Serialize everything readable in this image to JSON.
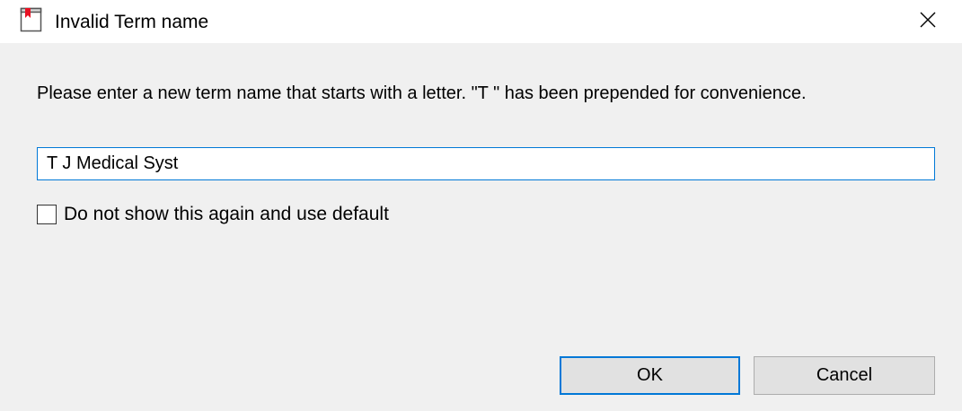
{
  "window": {
    "title": "Invalid Term name",
    "app_icon": "document-bookmark-icon",
    "close_icon": "close-icon"
  },
  "dialog": {
    "message": "Please enter a new term name that starts with a letter.  \"T \" has been prepended for convenience.",
    "term_input": {
      "value": "T J Medical Syst"
    },
    "checkbox": {
      "label": "Do not show this again and use default",
      "checked": false
    },
    "buttons": {
      "ok_label": "OK",
      "cancel_label": "Cancel"
    }
  },
  "colors": {
    "accent": "#0078d7",
    "icon_red": "#e81123",
    "dialog_bg": "#f0f0f0",
    "button_bg": "#e1e1e1"
  }
}
